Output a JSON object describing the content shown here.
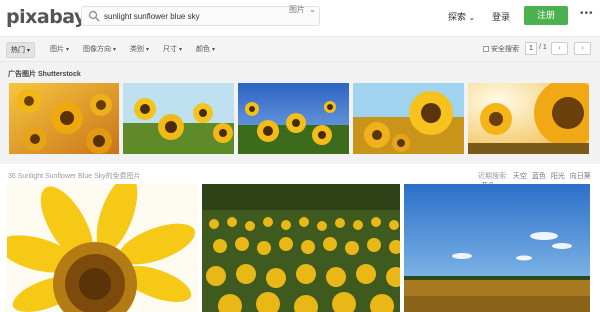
{
  "header": {
    "logo": "pixabay",
    "search_value": "sunlight sunflower blue sky",
    "search_type": "图片",
    "explore": "探索",
    "login": "登录",
    "signup": "注册"
  },
  "filters": {
    "items": [
      "热门",
      "图片",
      "图像方向",
      "类别",
      "尺寸",
      "颜色"
    ],
    "safe_search": "安全搜索",
    "page_current": "1",
    "page_total": "/ 1"
  },
  "sponsored": {
    "title": "广告图片 Shutterstock"
  },
  "results": {
    "title": "36 Sunlight Sunflower Blue Sky的免费图片",
    "related_label": "近期搜索:",
    "related": [
      "天空",
      "蓝色",
      "阳光",
      "向日葵",
      "黄色"
    ]
  },
  "colors": {
    "brand_green": "#4bb04f"
  }
}
